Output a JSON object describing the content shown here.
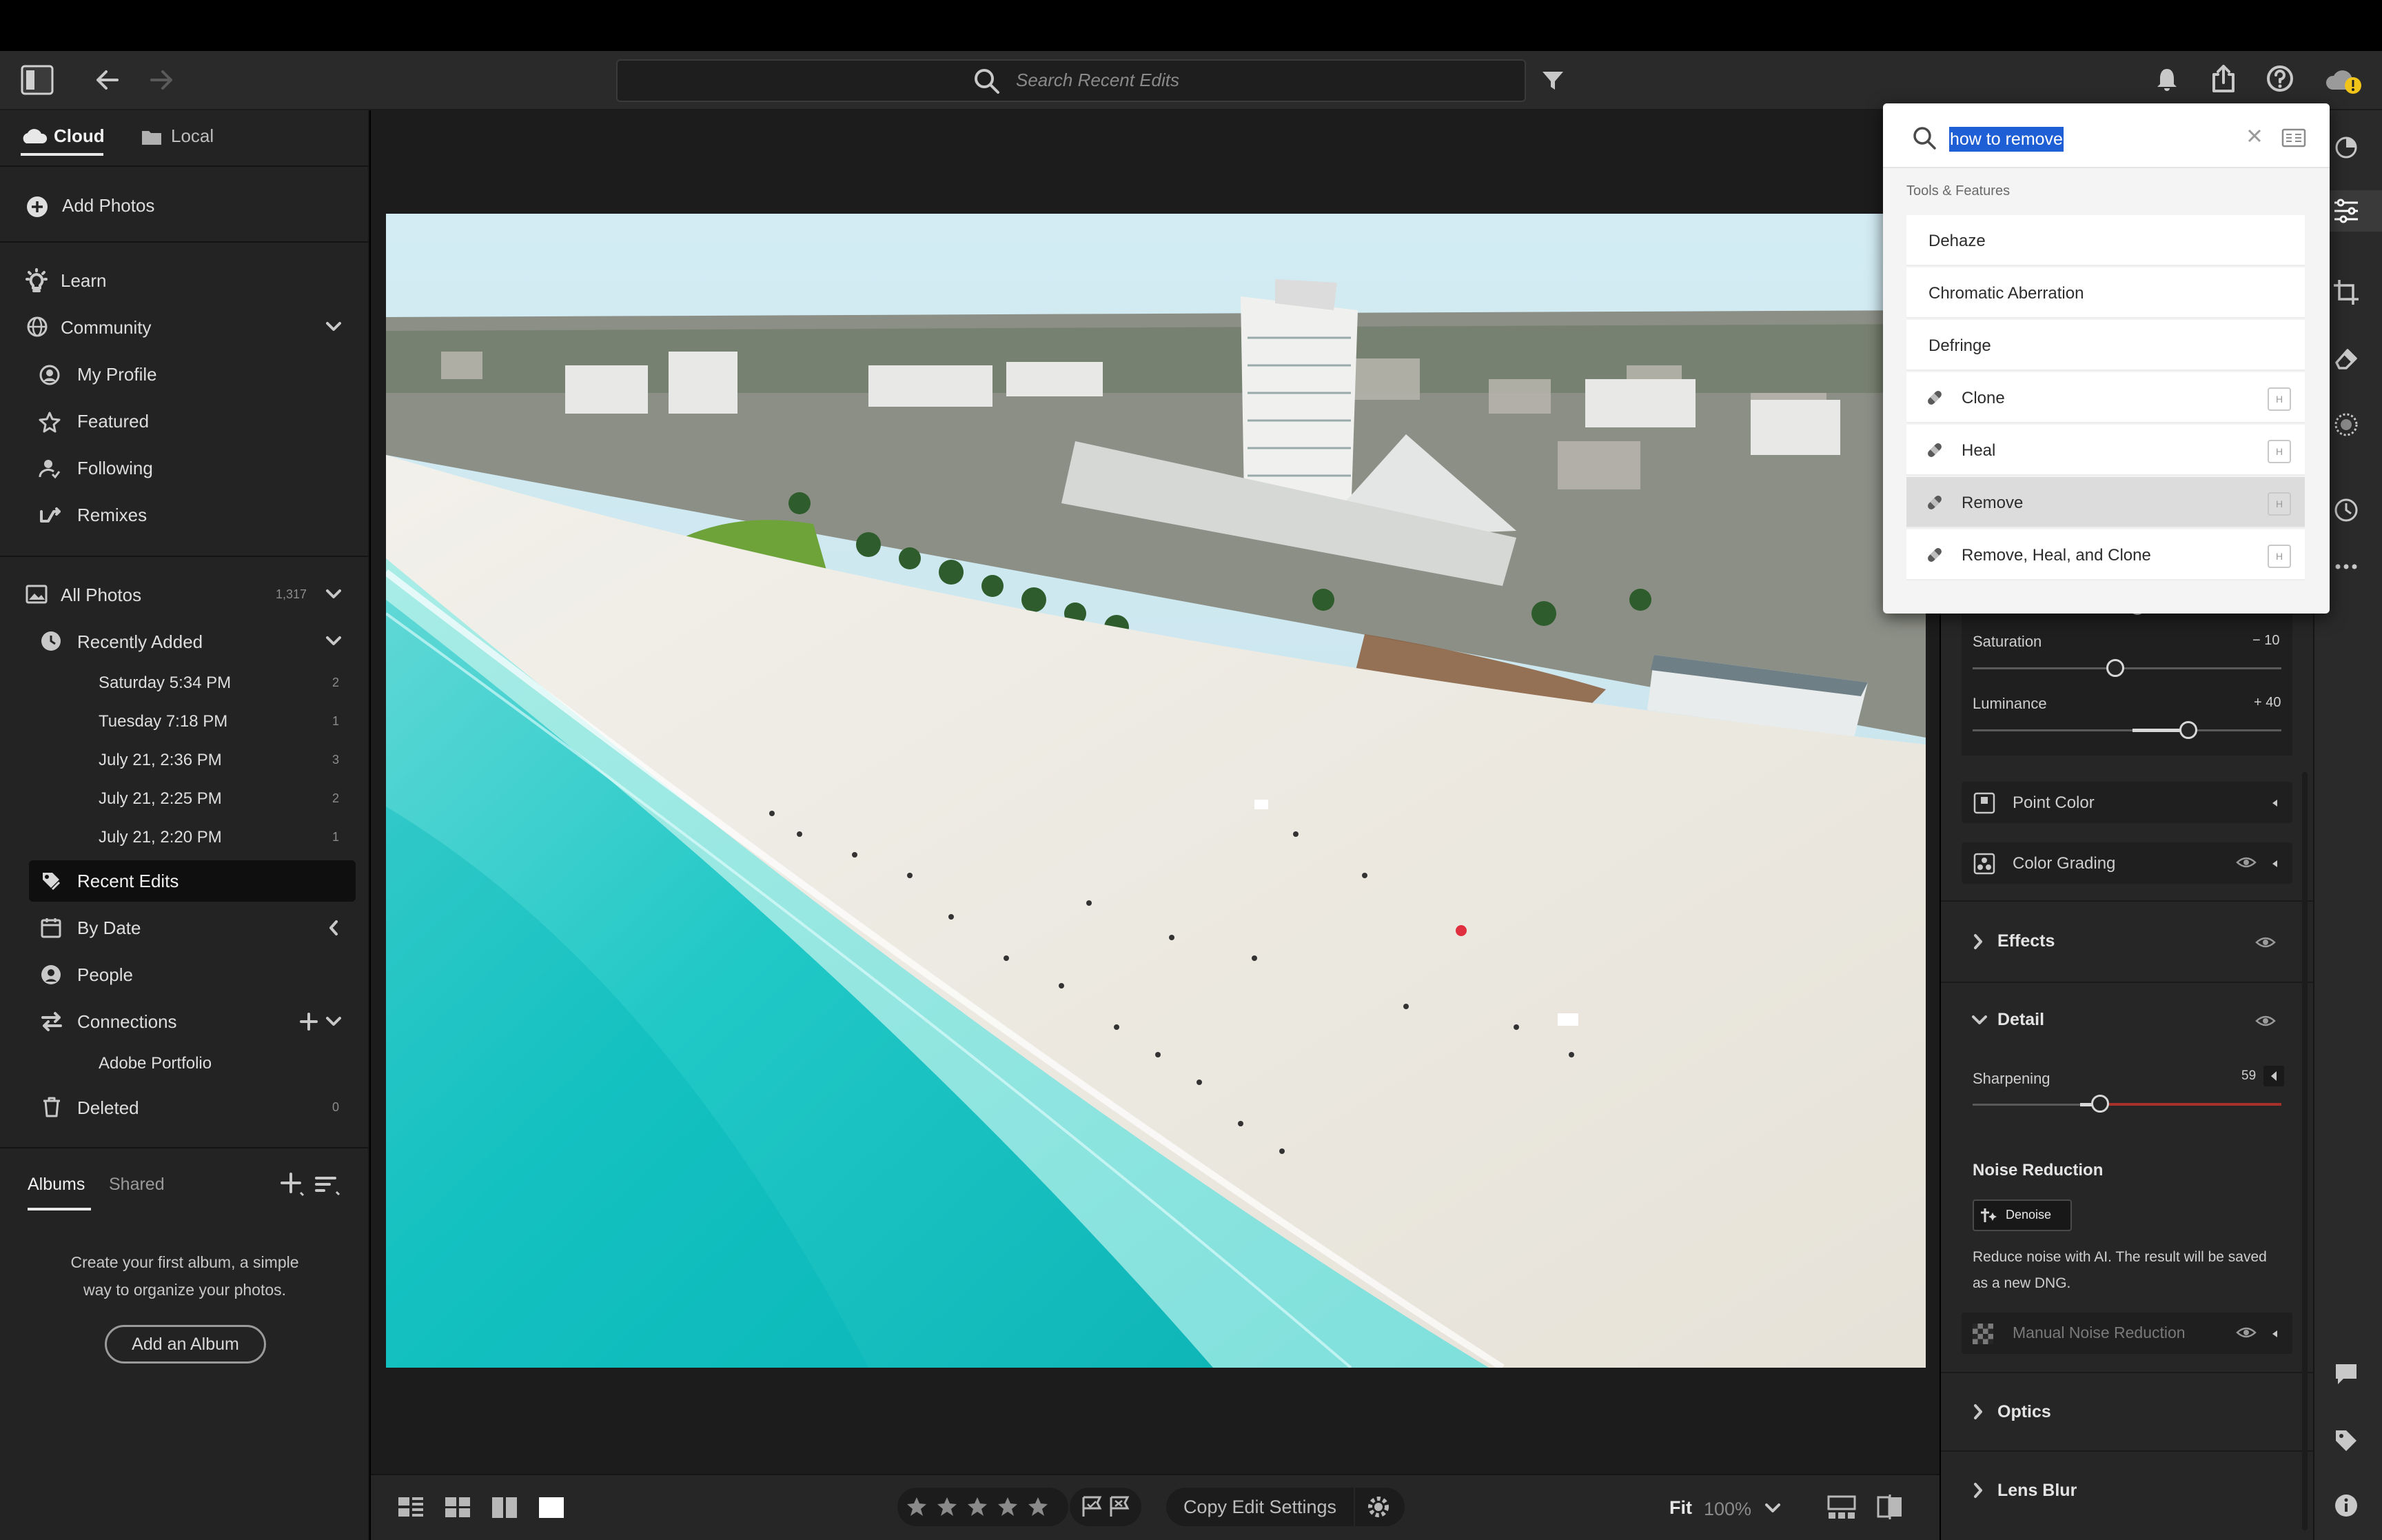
{
  "topbar": {
    "search_placeholder": "Search Recent Edits"
  },
  "sidebar": {
    "tabs": [
      {
        "label": "Cloud"
      },
      {
        "label": "Local"
      }
    ],
    "add_photos": "Add Photos",
    "learn": "Learn",
    "community": "Community",
    "community_items": [
      {
        "label": "My Profile"
      },
      {
        "label": "Featured"
      },
      {
        "label": "Following"
      },
      {
        "label": "Remixes"
      }
    ],
    "all_photos": {
      "label": "All Photos",
      "count": "1,317"
    },
    "recently_added": "Recently Added",
    "recent_groups": [
      {
        "label": "Saturday  5:34 PM",
        "count": "2"
      },
      {
        "label": "Tuesday  7:18 PM",
        "count": "1"
      },
      {
        "label": "July 21, 2:36 PM",
        "count": "3"
      },
      {
        "label": "July 21, 2:25 PM",
        "count": "2"
      },
      {
        "label": "July 21, 2:20 PM",
        "count": "1"
      }
    ],
    "recent_edits": "Recent Edits",
    "by_date": "By Date",
    "people": "People",
    "connections": "Connections",
    "adobe_portfolio": "Adobe Portfolio",
    "deleted": {
      "label": "Deleted",
      "count": "0"
    },
    "album_tabs": [
      {
        "label": "Albums"
      },
      {
        "label": "Shared"
      }
    ],
    "album_empty_line1": "Create your first album, a simple",
    "album_empty_line2": "way to organize your photos.",
    "add_album": "Add an Album"
  },
  "bottombar": {
    "copy_edit_settings": "Copy Edit Settings",
    "zoom_fit": "Fit",
    "zoom_level": "100%"
  },
  "edit_panel": {
    "saturation": {
      "label": "Saturation",
      "value": "− 10",
      "level": -10
    },
    "luminance": {
      "label": "Luminance",
      "value": "+ 40",
      "level": 40
    },
    "point_color": "Point Color",
    "color_grading": "Color Grading",
    "effects": "Effects",
    "detail": "Detail",
    "sharpening": {
      "label": "Sharpening",
      "value": "59",
      "level": 59
    },
    "noise_reduction": "Noise Reduction",
    "denoise": "Denoise",
    "denoise_desc_line1": "Reduce noise with AI. The result will be saved",
    "denoise_desc_line2": "as a new DNG.",
    "manual_noise": "Manual Noise Reduction",
    "optics": "Optics",
    "lens_blur": "Lens Blur"
  },
  "search_popup": {
    "query": "how to remove",
    "section": "Tools & Features",
    "results": [
      {
        "label": "Dehaze",
        "key": ""
      },
      {
        "label": "Chromatic Aberration",
        "key": ""
      },
      {
        "label": "Defringe",
        "key": ""
      },
      {
        "label": "Clone",
        "key": "H"
      },
      {
        "label": "Heal",
        "key": "H"
      },
      {
        "label": "Remove",
        "key": "H",
        "selected": true
      },
      {
        "label": "Remove, Heal, and Clone",
        "key": "H"
      }
    ]
  },
  "colors": {
    "accent_selection": "#1f5fd6",
    "warning_badge": "#f0c419",
    "sharpening_track": "#c0392b"
  },
  "icons": {
    "selection_highlight": "#2a63d3"
  }
}
